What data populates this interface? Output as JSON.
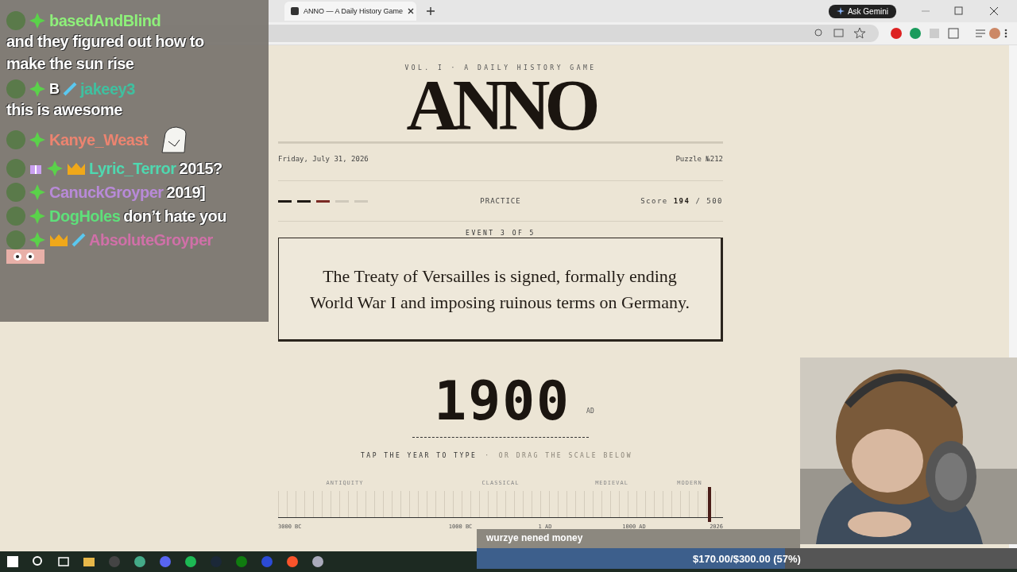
{
  "browser": {
    "tabs": [
      {
        "title": "ANNO — A Daily History Game",
        "selected": true
      }
    ],
    "gemini_button": "Ask Gemini"
  },
  "page": {
    "kicker": "VOL. I · A DAILY HISTORY GAME",
    "title": "ANNO",
    "date": "Friday, July 31, 2026",
    "puzzle": "Puzzle №212",
    "progress": [
      {
        "kind": "done"
      },
      {
        "kind": "done"
      },
      {
        "kind": "current"
      },
      {
        "kind": "pending"
      },
      {
        "kind": "pending"
      }
    ],
    "mode": "PRACTICE",
    "score_label": "Score",
    "score": "194",
    "score_total": "/ 500",
    "event_label": "EVENT 3 OF 5",
    "event_text": "The Treaty of Versailles is signed, formally ending World War I and imposing ruinous terms on Germany.",
    "year": "1900",
    "era_suffix": "AD",
    "hint_primary": "TAP THE YEAR TO TYPE",
    "hint_separator": "·",
    "hint_secondary": "OR DRAG THE SCALE BELOW",
    "scale": {
      "eras": [
        "ANTIQUITY",
        "CLASSICAL",
        "MEDIEVAL",
        "MODERN"
      ],
      "axis": [
        "3000 BC",
        "1000 BC",
        "1 AD",
        "1000 AD",
        "2026"
      ],
      "level": 0.97
    }
  },
  "chat": [
    {
      "user": "basedAndBlind",
      "color": "#8ef07a",
      "badges": [
        {
          "kind": "sub"
        }
      ],
      "kind": "stacked",
      "text": "and they figured out how to make the sun rise"
    },
    {
      "user": "jakeey3",
      "color": "#3fc0a0",
      "badges": [
        {
          "kind": "sub"
        },
        {
          "kind": "letter"
        },
        {
          "kind": "sword"
        }
      ],
      "badge_text": "B",
      "kind": "stacked",
      "text": "this is awesome"
    },
    {
      "user": "Kanye_Weast",
      "color": "#ec8470",
      "badges": [
        {
          "kind": "sub"
        }
      ],
      "kind": "emote"
    },
    {
      "user": "Lyric_Terror",
      "color": "#4fd8b0",
      "badges": [
        {
          "kind": "gift"
        },
        {
          "kind": "sub"
        },
        {
          "kind": "crown"
        }
      ],
      "kind": "inline",
      "text": "2015?"
    },
    {
      "user": "CanuckGroyper",
      "color": "#b88ad8",
      "badges": [
        {
          "kind": "sub"
        }
      ],
      "kind": "inline",
      "text": "2019]"
    },
    {
      "user": "DogHoles",
      "color": "#5ee07a",
      "badges": [
        {
          "kind": "sub"
        }
      ],
      "kind": "inline",
      "text": "don’t hate you"
    },
    {
      "user": "AbsoluteGroyper",
      "color": "#d070a8",
      "badges": [
        {
          "kind": "sub"
        },
        {
          "kind": "crown"
        },
        {
          "kind": "sword"
        }
      ],
      "kind": "cut"
    }
  ],
  "donation": {
    "title": "wurzye nened money",
    "amount": "$170.00/$300.00 (57%)",
    "level": 0.57
  }
}
